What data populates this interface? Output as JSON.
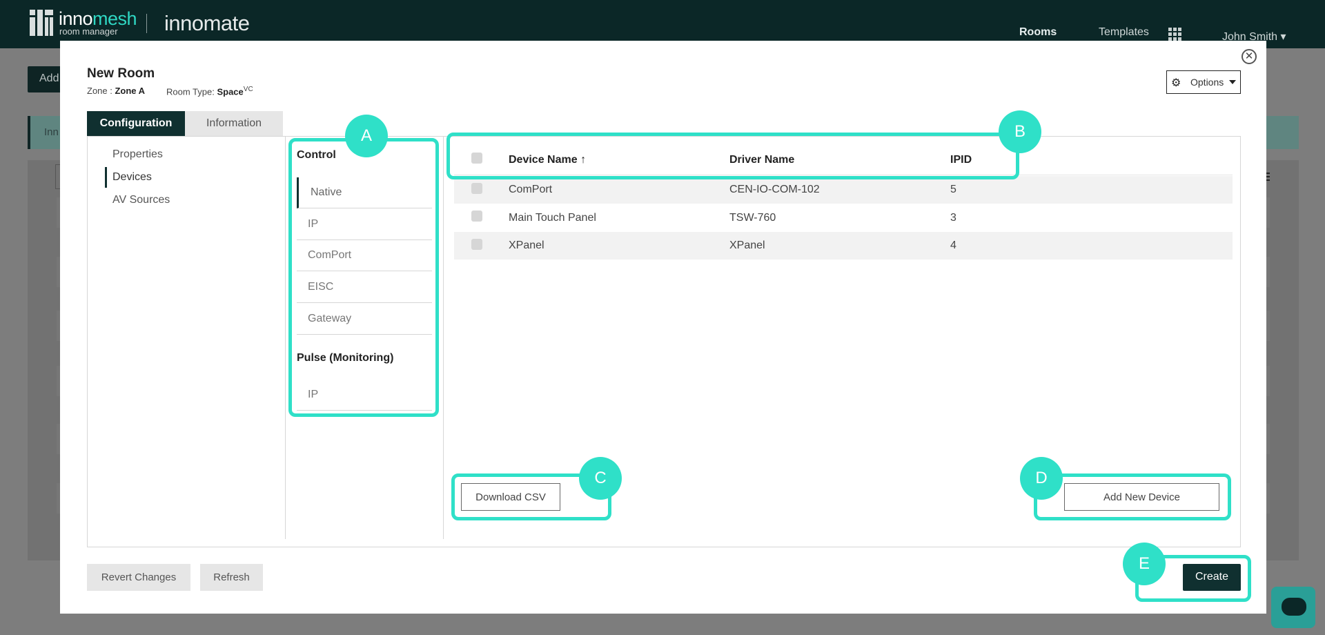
{
  "topbar": {
    "logo_primary": "inno",
    "logo_highlight": "mesh",
    "logo_sub": "room manager",
    "brand": "innomate",
    "nav_rooms": "Rooms",
    "nav_templates": "Templates",
    "user_menu": "John Smith ▾"
  },
  "background": {
    "add_button": "Add",
    "banner_text": "Inn"
  },
  "modal": {
    "title": "New Room",
    "zone_label": "Zone : ",
    "zone_value": "Zone A",
    "room_type_label": "Room Type: ",
    "room_type_value": "Space",
    "room_type_sup": "VC",
    "options_label": "Options",
    "close_symbol": "✕",
    "tabs": [
      {
        "label": "Configuration",
        "active": true
      },
      {
        "label": "Information",
        "active": false
      }
    ],
    "sidebar": [
      {
        "label": "Properties",
        "active": false
      },
      {
        "label": "Devices",
        "active": true
      },
      {
        "label": "AV Sources",
        "active": false
      }
    ],
    "categories": {
      "control_heading": "Control",
      "control_items": [
        "Native",
        "IP",
        "ComPort",
        "EISC",
        "Gateway"
      ],
      "pulse_heading": "Pulse (Monitoring)",
      "pulse_items": [
        "IP"
      ]
    },
    "table": {
      "headers": {
        "device_name": "Device Name ↑",
        "driver_name": "Driver Name",
        "ipid": "IPID"
      },
      "rows": [
        {
          "device_name": "ComPort",
          "driver_name": "CEN-IO-COM-102",
          "ipid": "5"
        },
        {
          "device_name": "Main Touch Panel",
          "driver_name": "TSW-760",
          "ipid": "3"
        },
        {
          "device_name": "XPanel",
          "driver_name": "XPanel",
          "ipid": "4"
        }
      ]
    },
    "buttons": {
      "download_csv": "Download CSV",
      "add_new_device": "Add New Device",
      "revert_changes": "Revert Changes",
      "refresh": "Refresh",
      "create": "Create"
    }
  },
  "callouts": {
    "a": "A",
    "b": "B",
    "c": "C",
    "d": "D",
    "e": "E"
  },
  "colors": {
    "topbar": "#0b2727",
    "accent": "#2fe0c8",
    "primary_button": "#103030",
    "overlay": "#7d7d7d"
  }
}
